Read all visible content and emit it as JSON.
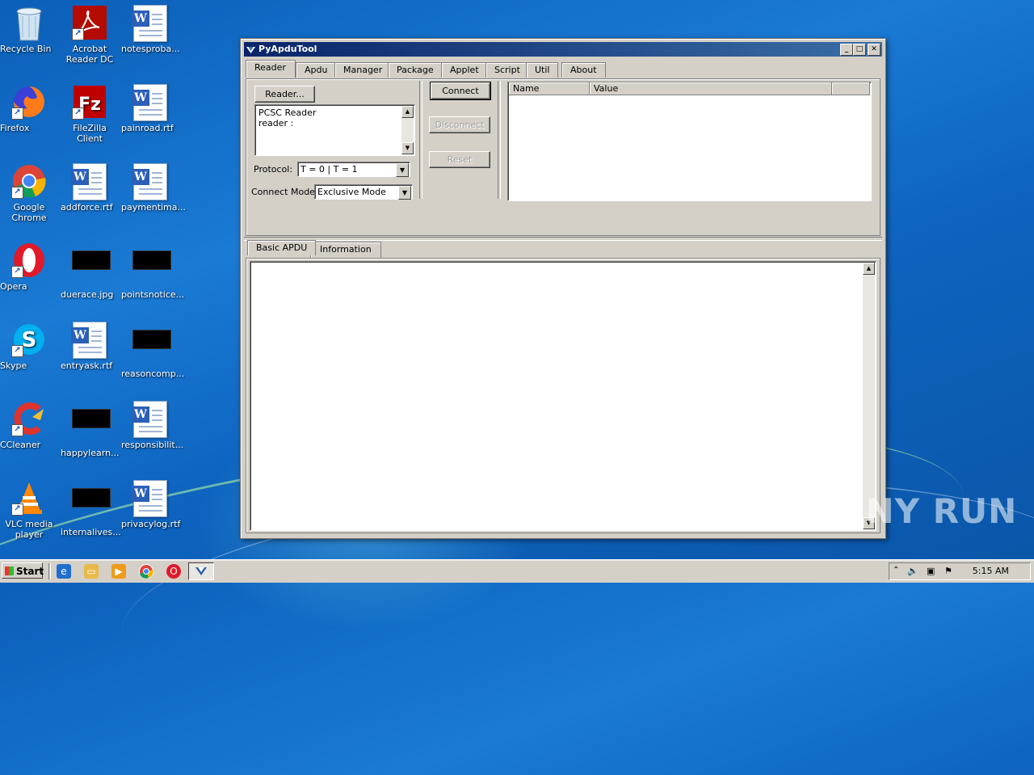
{
  "desktop": {
    "icons": [
      {
        "label": "Recycle Bin",
        "icon": "recycle-bin-icon"
      },
      {
        "label": "Acrobat Reader DC",
        "icon": "acrobat-icon"
      },
      {
        "label": "notesproba...",
        "icon": "word-doc-icon"
      },
      {
        "label": "Firefox",
        "icon": "firefox-icon"
      },
      {
        "label": "FileZilla Client",
        "icon": "filezilla-icon"
      },
      {
        "label": "painroad.rtf",
        "icon": "word-doc-icon"
      },
      {
        "label": "Google Chrome",
        "icon": "chrome-icon"
      },
      {
        "label": "addforce.rtf",
        "icon": "word-doc-icon"
      },
      {
        "label": "paymentima...",
        "icon": "word-doc-icon"
      },
      {
        "label": "Opera",
        "icon": "opera-icon"
      },
      {
        "label": "duerace.jpg",
        "icon": "image-thumb-icon"
      },
      {
        "label": "pointsnotice...",
        "icon": "image-thumb-icon"
      },
      {
        "label": "Skype",
        "icon": "skype-icon"
      },
      {
        "label": "entryask.rtf",
        "icon": "word-doc-icon"
      },
      {
        "label": "reasoncomp...",
        "icon": "image-thumb-icon"
      },
      {
        "label": "CCleaner",
        "icon": "ccleaner-icon"
      },
      {
        "label": "happylearn...",
        "icon": "image-thumb-icon"
      },
      {
        "label": "responsibilit...",
        "icon": "word-doc-icon"
      },
      {
        "label": "VLC media player",
        "icon": "vlc-icon"
      },
      {
        "label": "internalives...",
        "icon": "image-thumb-icon"
      },
      {
        "label": "privacylog.rtf",
        "icon": "word-doc-icon"
      }
    ]
  },
  "window": {
    "title": "PyApduTool",
    "controls": {
      "minimize": "_",
      "maximize": "□",
      "close": "✕"
    },
    "tabs": [
      "Reader",
      "Apdu",
      "Manager",
      "Package",
      "Applet",
      "Script",
      "Util",
      "About"
    ],
    "active_tab": "Reader",
    "reader": {
      "reader_button": "Reader...",
      "reader_list": [
        "PCSC Reader",
        "reader :"
      ],
      "protocol_label": "Protocol:",
      "protocol_value": "T = 0 | T = 1",
      "connect_mode_label": "Connect Mode:",
      "connect_mode_value": "Exclusive Mode",
      "connect_button": "Connect",
      "disconnect_button": "Disconnect",
      "reset_button": "Reset",
      "table_columns": [
        "Name",
        "Value"
      ]
    },
    "bottom_tabs": [
      "Basic APDU",
      "Information"
    ],
    "bottom_active_tab": "Basic APDU"
  },
  "taskbar": {
    "start_label": "Start",
    "clock": "5:15 AM",
    "pinned": [
      "ie-icon",
      "explorer-icon",
      "media-player-icon",
      "chrome-icon",
      "opera-icon",
      "pyapdutool-icon"
    ]
  },
  "watermark": "ANY RUN"
}
